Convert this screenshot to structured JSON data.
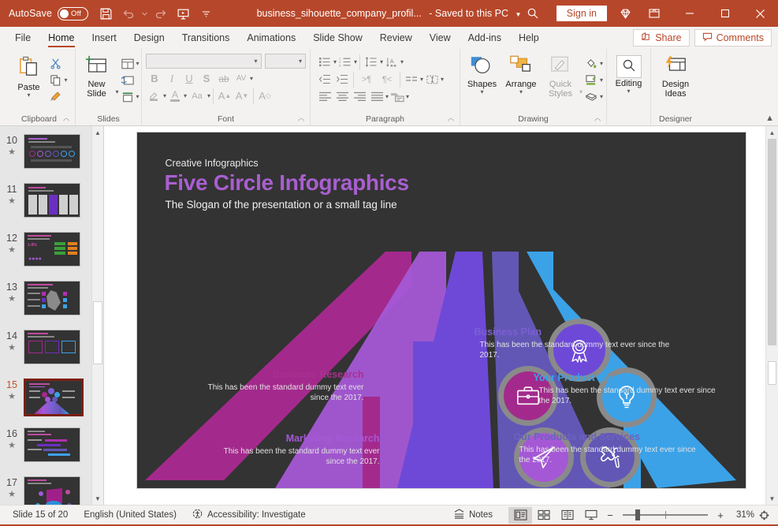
{
  "titlebar": {
    "autosave_label": "AutoSave",
    "autosave_state": "Off",
    "save_icon": "save-icon",
    "undo_icon": "undo-icon",
    "redo_icon": "redo-icon",
    "present_icon": "start-presentation-icon",
    "customize_icon": "customize-quick-access-toolbar-icon",
    "document_title": "business_sihouette_company_profil...",
    "save_state": "- Saved to this PC",
    "search_icon": "search-icon",
    "signin_label": "Sign in",
    "diamond_icon": "diamond-icon",
    "ribbon_display_icon": "ribbon-display-options-icon",
    "minimize_icon": "minimize-icon",
    "maximize_icon": "maximize-icon",
    "close_icon": "close-icon",
    "bg_color": "#b7472a"
  },
  "ribbon": {
    "tabs": [
      {
        "label": "File",
        "active": false
      },
      {
        "label": "Home",
        "active": true
      },
      {
        "label": "Insert",
        "active": false
      },
      {
        "label": "Design",
        "active": false
      },
      {
        "label": "Transitions",
        "active": false
      },
      {
        "label": "Animations",
        "active": false
      },
      {
        "label": "Slide Show",
        "active": false
      },
      {
        "label": "Review",
        "active": false
      },
      {
        "label": "View",
        "active": false
      },
      {
        "label": "Add-ins",
        "active": false
      },
      {
        "label": "Help",
        "active": false
      }
    ],
    "share_label": "Share",
    "comments_label": "Comments",
    "collapse_icon": "collapse-ribbon-icon",
    "groups": {
      "clipboard": {
        "label": "Clipboard",
        "paste_label": "Paste",
        "cut_icon": "scissors-icon",
        "copy_icon": "copy-icon",
        "format_painter_icon": "format-painter-icon",
        "launcher_icon": "dialog-launcher-icon"
      },
      "slides": {
        "label": "Slides",
        "new_slide_label": "New\nSlide",
        "layout_icon": "slide-layout-icon",
        "reset_icon": "reset-slide-icon",
        "section_icon": "section-icon"
      },
      "font": {
        "label": "Font",
        "font_name_value": "",
        "font_size_value": "",
        "bold": "B",
        "italic": "I",
        "underline": "U",
        "shadow": "S",
        "strikethrough": "ab",
        "spacing": "AV",
        "highlight_icon": "text-highlight-icon",
        "fontcolor_icon": "font-color-icon",
        "changecase_label": "Aa",
        "grow_label": "A",
        "shrink_label": "A",
        "clear_format_icon": "clear-formatting-icon",
        "launcher_icon": "dialog-launcher-icon"
      },
      "paragraph": {
        "label": "Paragraph",
        "bullets_icon": "bullets-icon",
        "numbering_icon": "numbering-icon",
        "linespacing_icon": "line-spacing-icon",
        "textdirection_icon": "text-direction-icon",
        "decrease_indent_icon": "decrease-indent-icon",
        "increase_indent_icon": "increase-indent-icon",
        "ltr_icon": "left-to-right-icon",
        "rtl_icon": "right-to-left-icon",
        "columns_icon": "columns-icon",
        "align_text_icon": "align-text-icon",
        "align_left_icon": "align-left-icon",
        "align_center_icon": "align-center-icon",
        "align_right_icon": "align-right-icon",
        "justify_icon": "justify-icon",
        "smartart_icon": "convert-to-smartart-icon",
        "launcher_icon": "dialog-launcher-icon"
      },
      "drawing": {
        "label": "Drawing",
        "shapes_label": "Shapes",
        "arrange_label": "Arrange",
        "quick_styles_label": "Quick\nStyles",
        "shape_fill_icon": "shape-fill-icon",
        "shape_outline_icon": "shape-outline-icon",
        "shape_effects_icon": "shape-effects-icon",
        "launcher_icon": "dialog-launcher-icon"
      },
      "editing": {
        "label": "",
        "editing_label": "Editing",
        "find_icon": "search-icon"
      },
      "designer": {
        "label": "Designer",
        "design_ideas_label": "Design\nIdeas",
        "design_ideas_icon": "design-ideas-icon"
      }
    }
  },
  "thumbnails": {
    "slides": [
      {
        "number": "10",
        "current": false,
        "star": "★"
      },
      {
        "number": "11",
        "current": false,
        "star": "★"
      },
      {
        "number": "12",
        "current": false,
        "star": "★"
      },
      {
        "number": "13",
        "current": false,
        "star": "★"
      },
      {
        "number": "14",
        "current": false,
        "star": "★"
      },
      {
        "number": "15",
        "current": true,
        "star": "★"
      },
      {
        "number": "16",
        "current": false,
        "star": "★"
      },
      {
        "number": "17",
        "current": false,
        "star": "★"
      }
    ],
    "scroll_up_icon": "scroll-up-icon",
    "scroll_down_icon": "scroll-down-icon"
  },
  "slide": {
    "background": "#333333",
    "eyebrow": "Creative Infographics",
    "title": "Five Circle Infographics",
    "title_color": "#a95fd0",
    "subtitle": "The Slogan of the presentation or a small tag line",
    "nodes": [
      {
        "id": "business-plan",
        "title": "Business Plan",
        "body": "This has been the standard dummy text ever since the 2017.",
        "color": "#7b5fd4",
        "title_color": "#7b5fd4",
        "icon": "award-ribbon-icon",
        "side": "right"
      },
      {
        "id": "business-research",
        "title": "Business Research",
        "body": "This has been the standard dummy text ever since the 2017.",
        "color": "#a32a8c",
        "title_color": "#a8308f",
        "icon": "briefcase-icon",
        "side": "left"
      },
      {
        "id": "your-product-launch",
        "title": "Your Product Launch",
        "body": "This has been the standard dummy text ever since the 2017.",
        "color": "#3ba2e8",
        "title_color": "#3ba2e8",
        "icon": "lightbulb-icon",
        "side": "right"
      },
      {
        "id": "marketing-research",
        "title": "Marketing Research",
        "body": "This has been the standard dummy text ever since the 2017.",
        "color": "#a558d6",
        "title_color": "#a558d6",
        "icon": "paper-plane-icon",
        "side": "left"
      },
      {
        "id": "our-products-and-services",
        "title": "Our Products and Services",
        "body": "This has been the standard dummy text ever since the 2017.",
        "color": "#6257b5",
        "title_color": "#6b63bd",
        "icon": "tools-icon",
        "side": "right"
      }
    ]
  },
  "statusbar": {
    "slide_counter": "Slide 15 of 20",
    "language": "English (United States)",
    "accessibility_icon": "accessibility-icon",
    "accessibility_label": "Accessibility: Investigate",
    "notes_label": "Notes",
    "notes_icon": "notes-icon",
    "views": [
      {
        "icon": "normal-view-icon",
        "active": true
      },
      {
        "icon": "slide-sorter-icon",
        "active": false
      },
      {
        "icon": "reading-view-icon",
        "active": false
      },
      {
        "icon": "slide-show-icon",
        "active": false
      }
    ],
    "zoom_out": "−",
    "zoom_in": "+",
    "zoom_level": "31%",
    "fit_icon": "fit-slide-to-window-icon"
  }
}
